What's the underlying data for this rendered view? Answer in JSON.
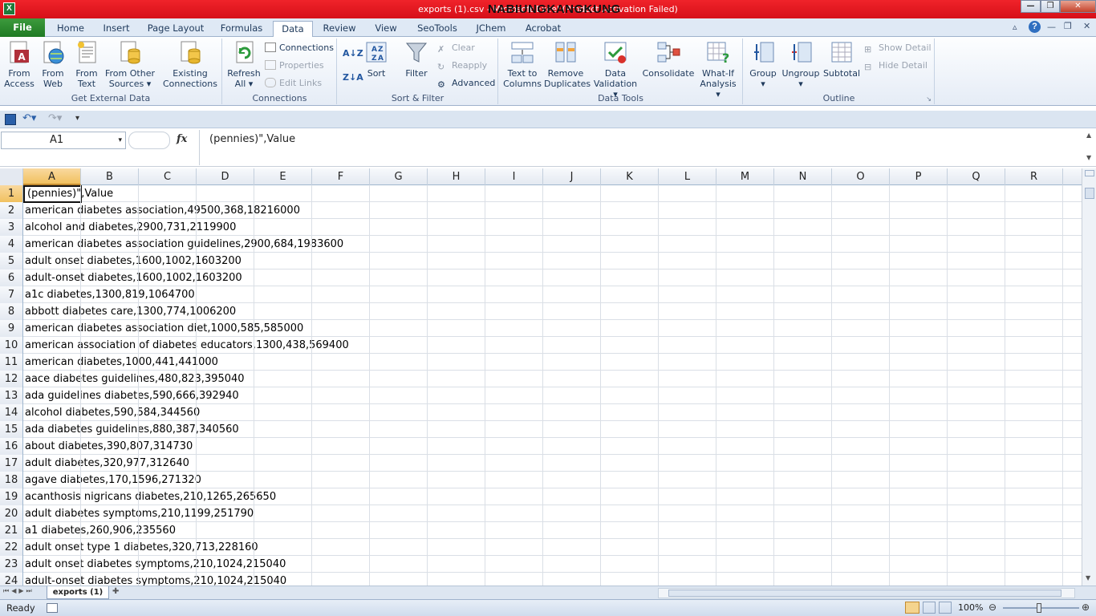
{
  "window": {
    "title": "exports (1).csv - Microsoft Excel (Product Activation Failed)",
    "overlay_text": "NABIUNGKANGKUNG"
  },
  "tabs": {
    "file": "File",
    "items": [
      "Home",
      "Insert",
      "Page Layout",
      "Formulas",
      "Data",
      "Review",
      "View",
      "SeoTools",
      "JChem",
      "Acrobat"
    ],
    "active": "Data"
  },
  "ribbon": {
    "get_external": {
      "label": "Get External Data",
      "from_access": [
        "From",
        "Access"
      ],
      "from_web": [
        "From",
        "Web"
      ],
      "from_text": [
        "From",
        "Text"
      ],
      "from_other": [
        "From Other",
        "Sources ▾"
      ],
      "existing": [
        "Existing",
        "Connections"
      ]
    },
    "connections": {
      "label": "Connections",
      "refresh": [
        "Refresh",
        "All ▾"
      ],
      "connections": "Connections",
      "properties": "Properties",
      "edit_links": "Edit Links"
    },
    "sort_filter": {
      "label": "Sort & Filter",
      "sort": "Sort",
      "filter": "Filter",
      "clear": "Clear",
      "reapply": "Reapply",
      "advanced": "Advanced"
    },
    "data_tools": {
      "label": "Data Tools",
      "text_to_columns": [
        "Text to",
        "Columns"
      ],
      "remove_duplicates": [
        "Remove",
        "Duplicates"
      ],
      "data_validation": [
        "Data",
        "Validation ▾"
      ],
      "consolidate": "Consolidate",
      "what_if": [
        "What-If",
        "Analysis ▾"
      ]
    },
    "outline": {
      "label": "Outline",
      "group": "Group",
      "ungroup": "Ungroup",
      "subtotal": "Subtotal",
      "show_detail": "Show Detail",
      "hide_detail": "Hide Detail"
    }
  },
  "formula_bar": {
    "name_box": "A1",
    "fx": "fx",
    "formula": "(pennies)\",Value"
  },
  "grid": {
    "columns": [
      "A",
      "B",
      "C",
      "D",
      "E",
      "F",
      "G",
      "H",
      "I",
      "J",
      "K",
      "L",
      "M",
      "N",
      "O",
      "P",
      "Q",
      "R"
    ],
    "rows": [
      {
        "n": "1",
        "text": "(pennies)\",Value"
      },
      {
        "n": "2",
        "text": "american diabetes association,49500,368,18216000"
      },
      {
        "n": "3",
        "text": "alcohol and diabetes,2900,731,2119900"
      },
      {
        "n": "4",
        "text": "american diabetes association guidelines,2900,684,1983600"
      },
      {
        "n": "5",
        "text": "adult onset diabetes,1600,1002,1603200"
      },
      {
        "n": "6",
        "text": "adult-onset diabetes,1600,1002,1603200"
      },
      {
        "n": "7",
        "text": "a1c diabetes,1300,819,1064700"
      },
      {
        "n": "8",
        "text": "abbott diabetes care,1300,774,1006200"
      },
      {
        "n": "9",
        "text": "american diabetes association diet,1000,585,585000"
      },
      {
        "n": "10",
        "text": "american association of diabetes educators,1300,438,569400"
      },
      {
        "n": "11",
        "text": "american diabetes,1000,441,441000"
      },
      {
        "n": "12",
        "text": "aace diabetes guidelines,480,823,395040"
      },
      {
        "n": "13",
        "text": "ada guidelines diabetes,590,666,392940"
      },
      {
        "n": "14",
        "text": "alcohol diabetes,590,584,344560"
      },
      {
        "n": "15",
        "text": "ada diabetes guidelines,880,387,340560"
      },
      {
        "n": "16",
        "text": "about diabetes,390,807,314730"
      },
      {
        "n": "17",
        "text": "adult diabetes,320,977,312640"
      },
      {
        "n": "18",
        "text": "agave diabetes,170,1596,271320"
      },
      {
        "n": "19",
        "text": "acanthosis nigricans diabetes,210,1265,265650"
      },
      {
        "n": "20",
        "text": "adult diabetes symptoms,210,1199,251790"
      },
      {
        "n": "21",
        "text": "a1 diabetes,260,906,235560"
      },
      {
        "n": "22",
        "text": "adult onset type 1 diabetes,320,713,228160"
      },
      {
        "n": "23",
        "text": "adult onset diabetes symptoms,210,1024,215040"
      },
      {
        "n": "24",
        "text": "adult-onset diabetes symptoms,210,1024,215040"
      }
    ]
  },
  "sheet": {
    "tab": "exports (1)"
  },
  "status": {
    "ready": "Ready",
    "zoom": "100%"
  },
  "colors": {
    "title_bar": "#e0141c",
    "file_tab": "#2a8a2e",
    "selection": "#f1c15f"
  }
}
